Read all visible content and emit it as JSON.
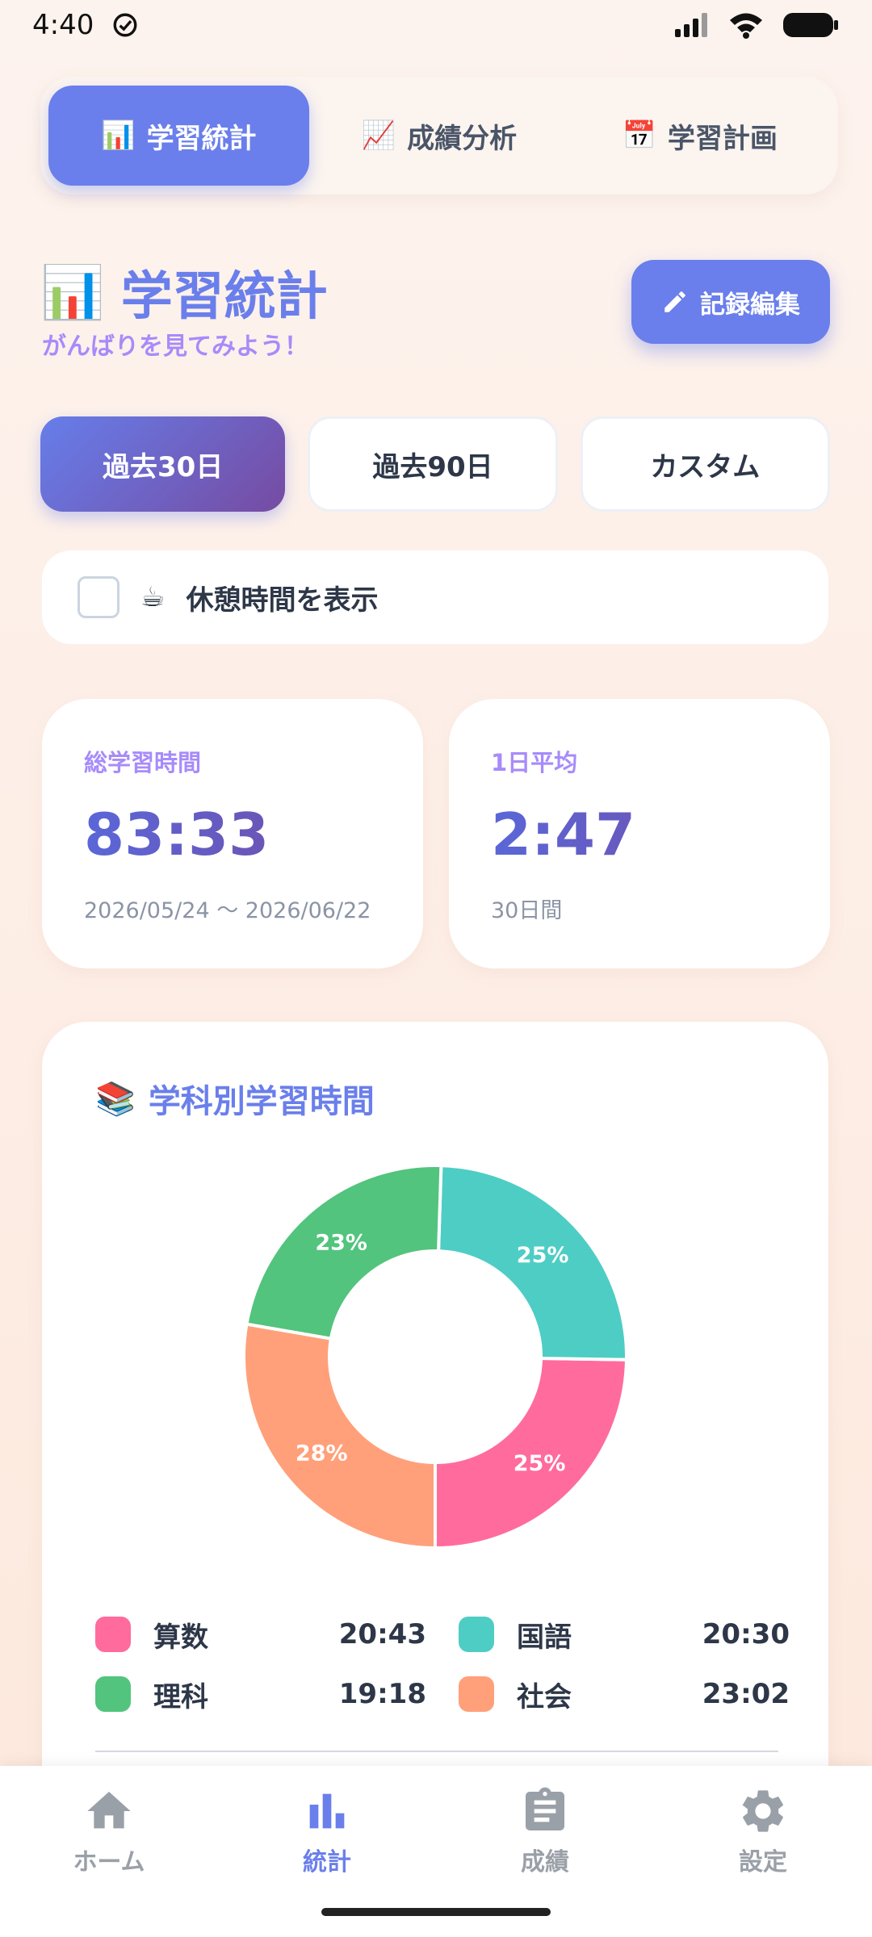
{
  "status_bar": {
    "time": "4:40"
  },
  "top_tabs": [
    {
      "icon": "📊",
      "label": "学習統計",
      "active": true
    },
    {
      "icon": "📈",
      "label": "成績分析",
      "active": false
    },
    {
      "icon": "📅",
      "label": "学習計画",
      "active": false
    }
  ],
  "header": {
    "icon": "📊",
    "title": "学習統計",
    "subtitle": "がんばりを見てみよう！",
    "edit_button": "記録編集"
  },
  "period_buttons": [
    {
      "label": "過去30日",
      "active": true
    },
    {
      "label": "過去90日",
      "active": false
    },
    {
      "label": "カスタム",
      "active": false
    }
  ],
  "break_toggle": {
    "icon": "☕",
    "label": "休憩時間を表示",
    "checked": false
  },
  "stats": {
    "total": {
      "label": "総学習時間",
      "value": "83:33",
      "range": "2026/05/24 〜 2026/06/22"
    },
    "average": {
      "label": "1日平均",
      "value": "2:47",
      "days": "30日間"
    }
  },
  "subject_card": {
    "icon": "📚",
    "title": "学科別学習時間"
  },
  "chart_data": {
    "type": "pie",
    "donut": true,
    "slices": [
      {
        "name": "算数",
        "time": "20:43",
        "percent_label": "25%",
        "color": "#ff6b9d"
      },
      {
        "name": "国語",
        "time": "20:30",
        "percent_label": "25%",
        "color": "#4ecdc4"
      },
      {
        "name": "理科",
        "time": "19:18",
        "percent_label": "23%",
        "color": "#52c47d"
      },
      {
        "name": "社会",
        "time": "23:02",
        "percent_label": "28%",
        "color": "#ffa07a"
      }
    ]
  },
  "bottom_nav": [
    {
      "label": "ホーム",
      "icon": "home-icon",
      "active": false
    },
    {
      "label": "統計",
      "icon": "bar-chart-icon",
      "active": true
    },
    {
      "label": "成績",
      "icon": "clipboard-icon",
      "active": false
    },
    {
      "label": "設定",
      "icon": "gear-icon",
      "active": false
    }
  ]
}
